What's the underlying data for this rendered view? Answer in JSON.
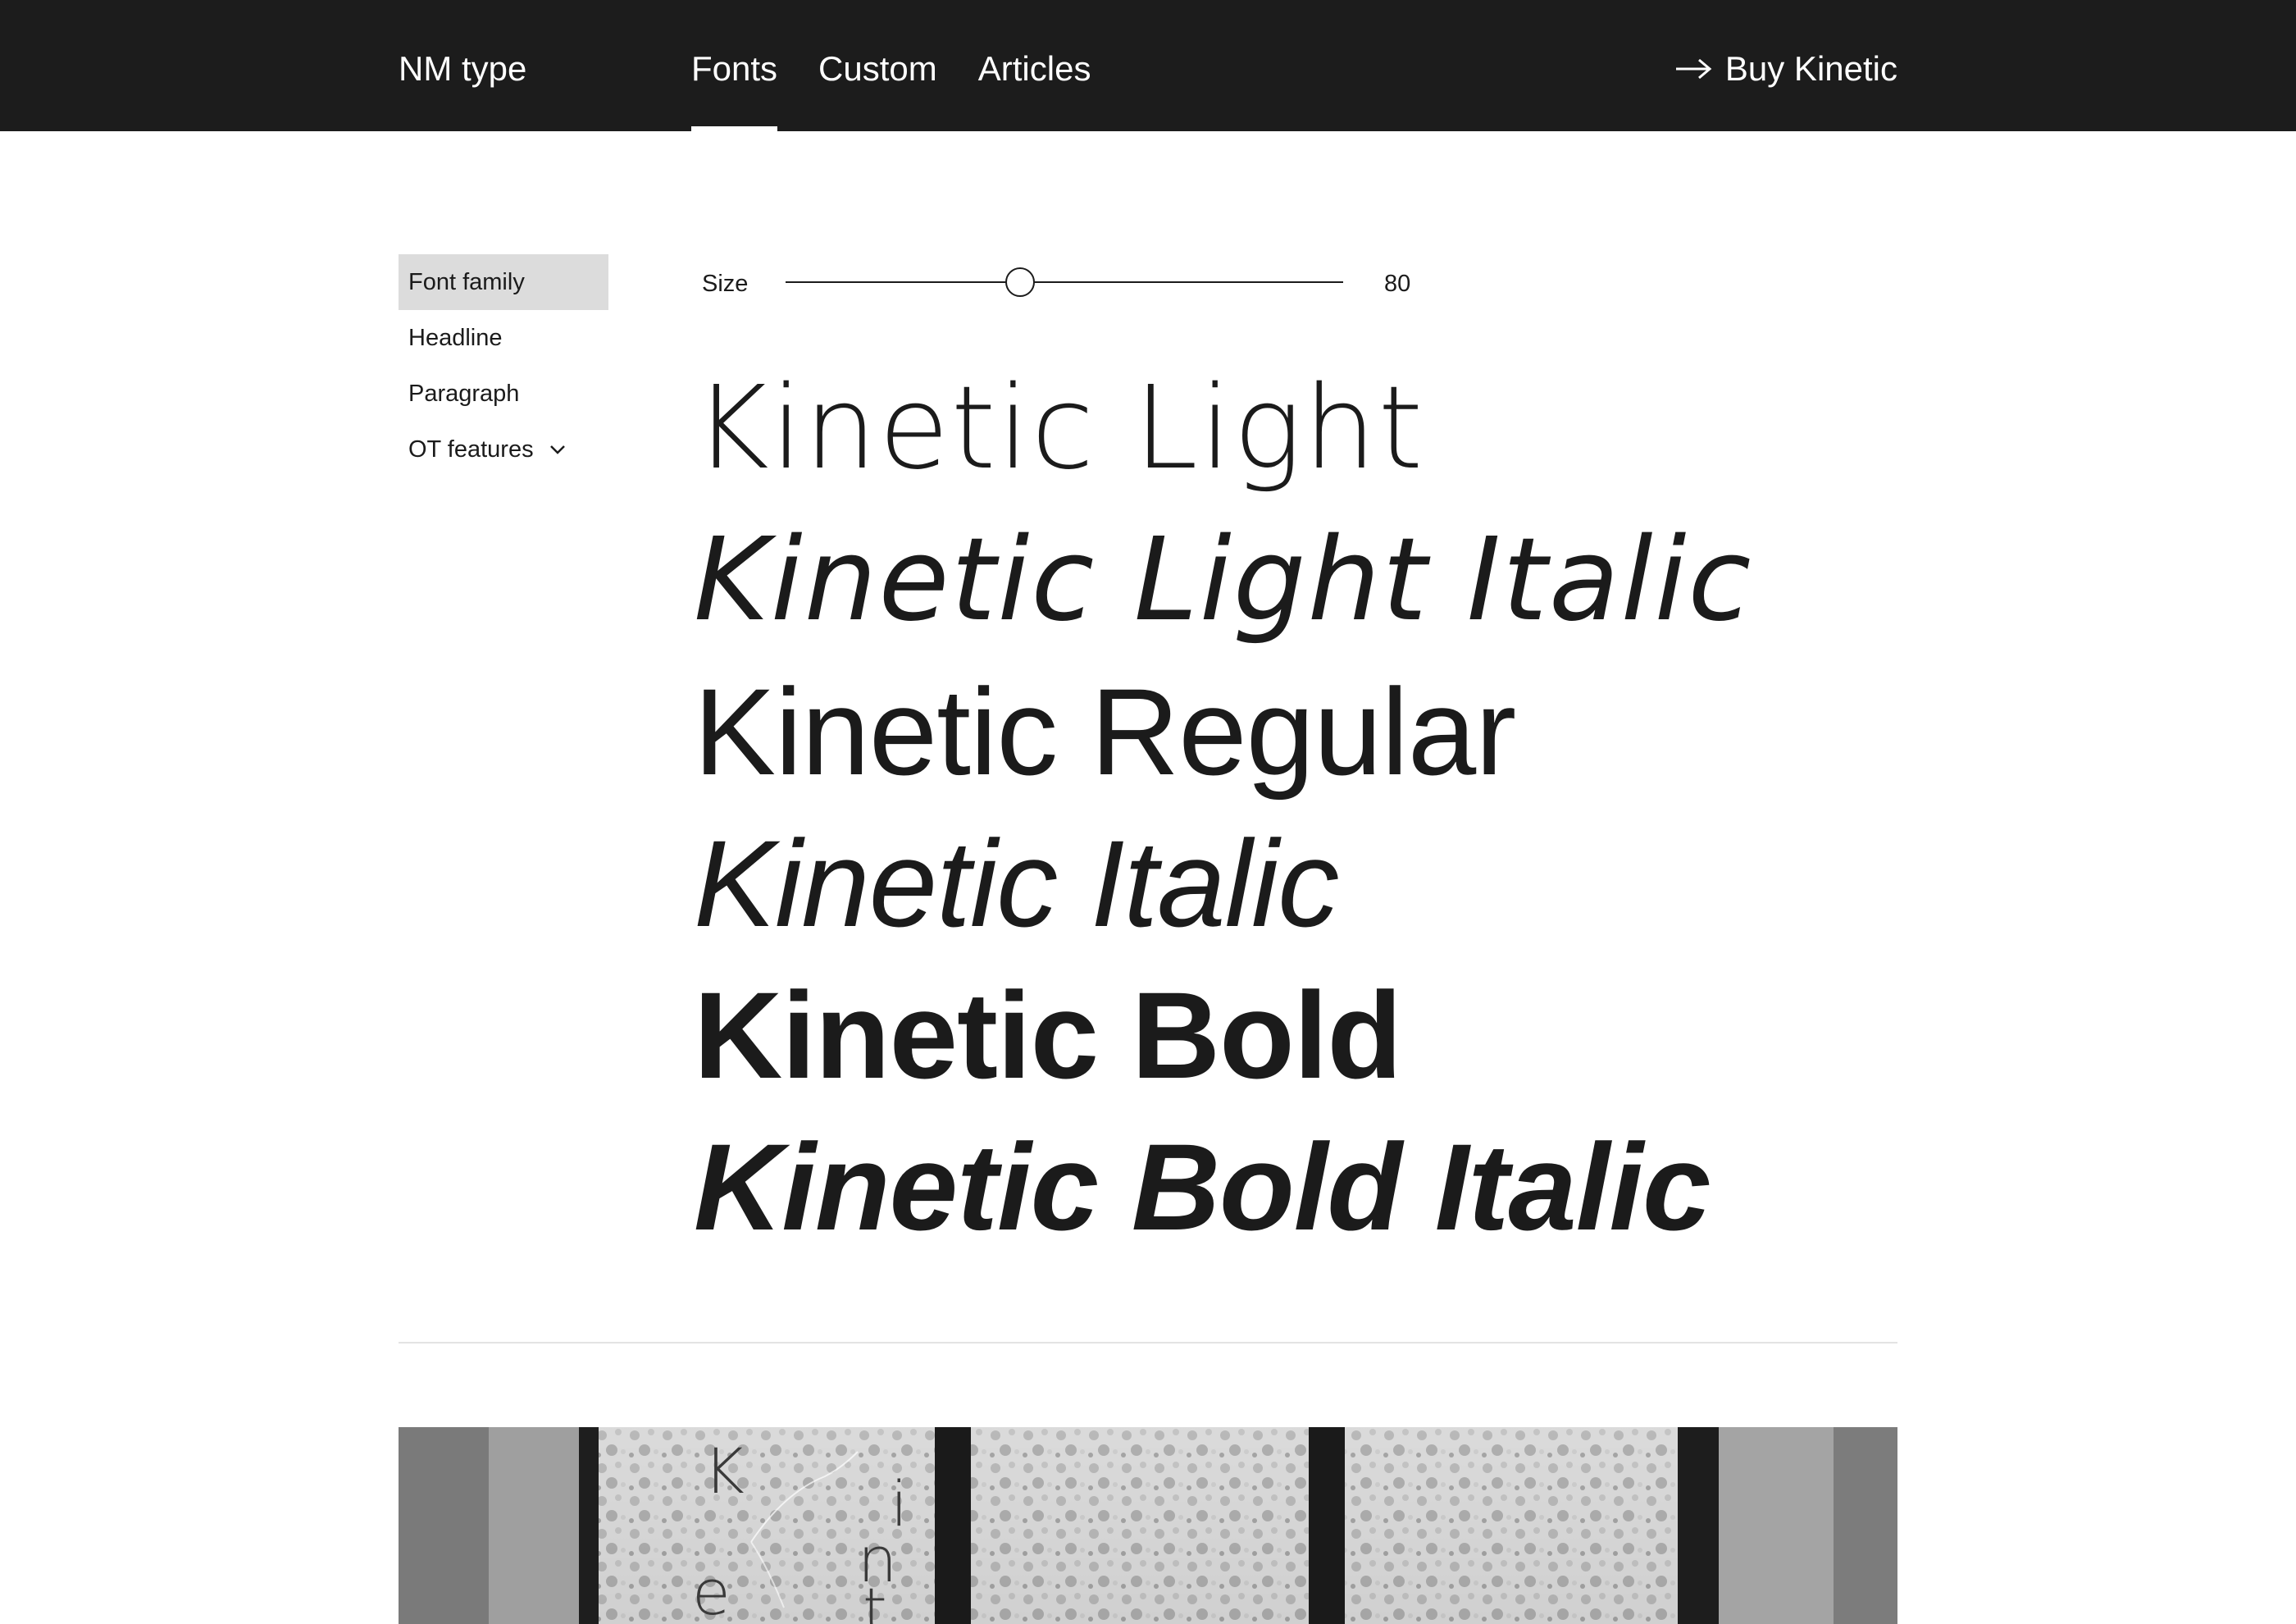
{
  "header": {
    "brand": "NM type",
    "nav": [
      {
        "label": "Fonts",
        "active": true
      },
      {
        "label": "Custom",
        "active": false
      },
      {
        "label": "Articles",
        "active": false
      }
    ],
    "buy_label": "Buy Kinetic",
    "buy_icon": "arrow-right-icon"
  },
  "sidebar": {
    "items": [
      {
        "label": "Font family",
        "active": true
      },
      {
        "label": "Headline",
        "active": false
      },
      {
        "label": "Paragraph",
        "active": false
      },
      {
        "label": "OT features",
        "active": false,
        "icon": "chevron-down-icon"
      }
    ]
  },
  "size_control": {
    "label": "Size",
    "value": "80",
    "fraction": 0.42
  },
  "specimens": [
    {
      "text": "Kinetic Light"
    },
    {
      "text": "Kinetic Light Italic"
    },
    {
      "text": "Kinetic Regular"
    },
    {
      "text": "Kinetic Italic"
    },
    {
      "text": "Kinetic Bold"
    },
    {
      "text": "Kinetic Bold Italic"
    }
  ],
  "photo": {
    "letters": [
      "K",
      "e",
      "i",
      "n",
      "t"
    ]
  },
  "colors": {
    "header_bg": "#1c1c1c",
    "active_menu_bg": "#dcdcdc",
    "text": "#1b1b1b",
    "divider": "#e3e3e3"
  }
}
